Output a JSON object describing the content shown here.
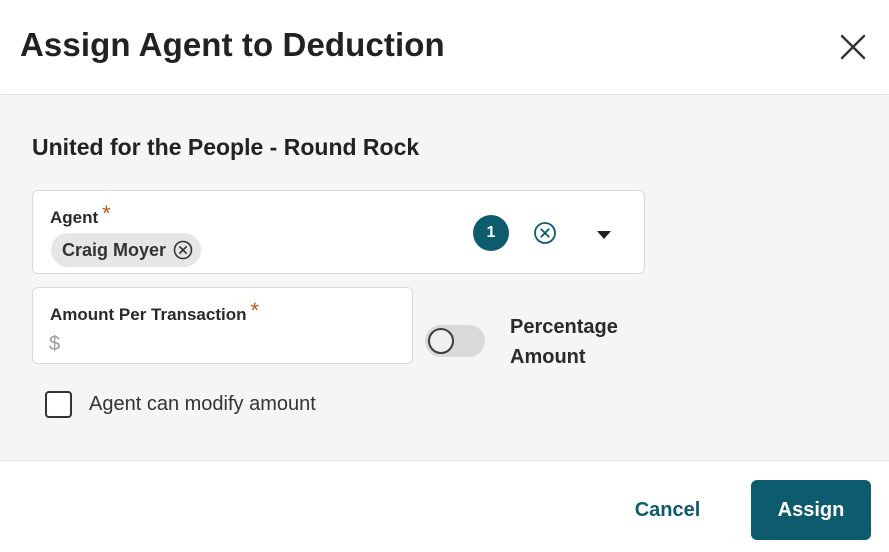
{
  "dialog": {
    "title": "Assign Agent to Deduction",
    "close_icon": "close-icon"
  },
  "form": {
    "subtitle": "United for the People - Round Rock",
    "agent": {
      "label": "Agent",
      "required_mark": "*",
      "selected_chip": "Craig Moyer",
      "selected_count": "1",
      "chip_remove_icon": "circle-x-icon",
      "clear_icon": "circle-x-icon",
      "dropdown_icon": "caret-down-icon"
    },
    "amount": {
      "label": "Amount Per Transaction",
      "required_mark": "*",
      "placeholder": "$",
      "value": ""
    },
    "percentage_toggle": {
      "label": "Percentage Amount",
      "on": false
    },
    "modify_checkbox": {
      "label": "Agent can modify amount",
      "checked": false
    }
  },
  "footer": {
    "cancel_label": "Cancel",
    "assign_label": "Assign"
  },
  "colors": {
    "primary": "#0e5b6e",
    "required": "#c0561e",
    "body_bg": "#f5f5f5"
  }
}
